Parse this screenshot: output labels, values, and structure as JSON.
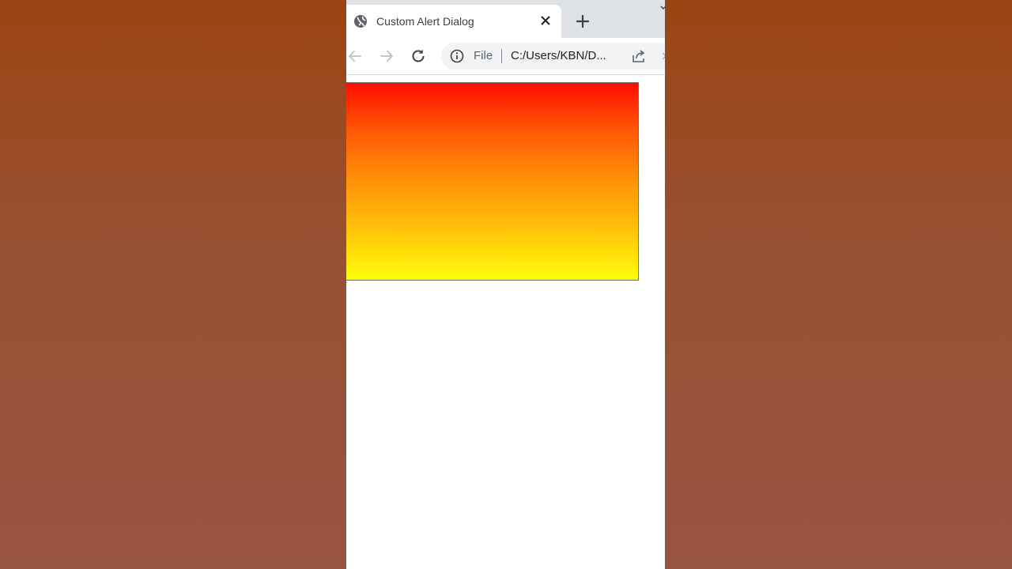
{
  "tab": {
    "title": "Custom Alert Dialog",
    "favicon": "globe-icon",
    "close_icon": "close-icon",
    "new_tab_icon": "plus-icon"
  },
  "toolbar": {
    "back_icon": "back-arrow-icon",
    "forward_icon": "forward-arrow-icon",
    "reload_icon": "reload-icon"
  },
  "omnibox": {
    "security_icon": "info-icon",
    "scheme_label": "File",
    "url": "C:/Users/KBN/D...",
    "share_icon": "share-icon"
  },
  "page": {
    "box_gradient": [
      "#ff0d00",
      "#ffff0a"
    ]
  },
  "colors": {
    "background": "#9a4e30",
    "tabstrip": "#dee1e6",
    "omnibox_bg": "#f1f3f4"
  }
}
